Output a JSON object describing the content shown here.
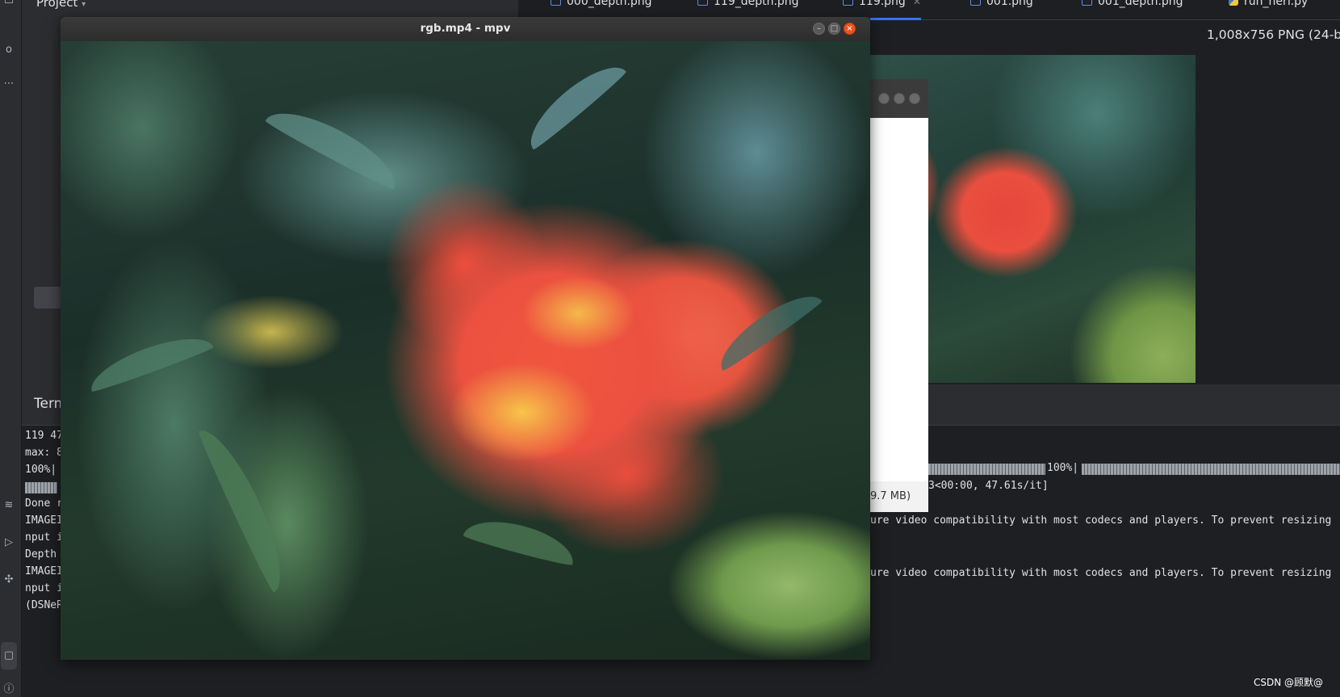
{
  "ide": {
    "project_title": "Project",
    "tabs": [
      {
        "label": "000_depth.png",
        "icon": "image-file-icon",
        "active": false
      },
      {
        "label": "119_depth.png",
        "icon": "image-file-icon",
        "active": false
      },
      {
        "label": "119.png",
        "icon": "image-file-icon",
        "active": true
      },
      {
        "label": "001.png",
        "icon": "image-file-icon",
        "active": false
      },
      {
        "label": "001_depth.png",
        "icon": "image-file-icon",
        "active": false
      },
      {
        "label": "run_nerf.py",
        "icon": "python-file-icon",
        "active": false
      }
    ],
    "image_info": "1,008x756 PNG (24-b",
    "terminal_title": "Terminal",
    "terminal_lines_left": [
      "119 47",
      "max: 8",
      "100%|",
      "",
      "Done r",
      "IMAGEI",
      "nput i",
      "Depth",
      "IMAGEI",
      "nput i",
      "(DSNeR"
    ],
    "terminal_right": {
      "progress_label": "100%|",
      "rate": "3<00:00, 47.61s/it]",
      "warn1": "ure video compatibility with most codecs and players. To prevent resizing",
      "warn2": "ure video compatibility with most codecs and players. To prevent resizing"
    },
    "secondary_window_footer": "9.7 MB)",
    "watermark": "CSDN @顾默@"
  },
  "mpv": {
    "title": "rgb.mp4 - mpv",
    "buttons": {
      "minimize": "–",
      "maximize": "□",
      "close": "×"
    }
  },
  "colors": {
    "accent": "#3574f0",
    "close_button": "#e9541f",
    "flower": "#ec5140"
  }
}
